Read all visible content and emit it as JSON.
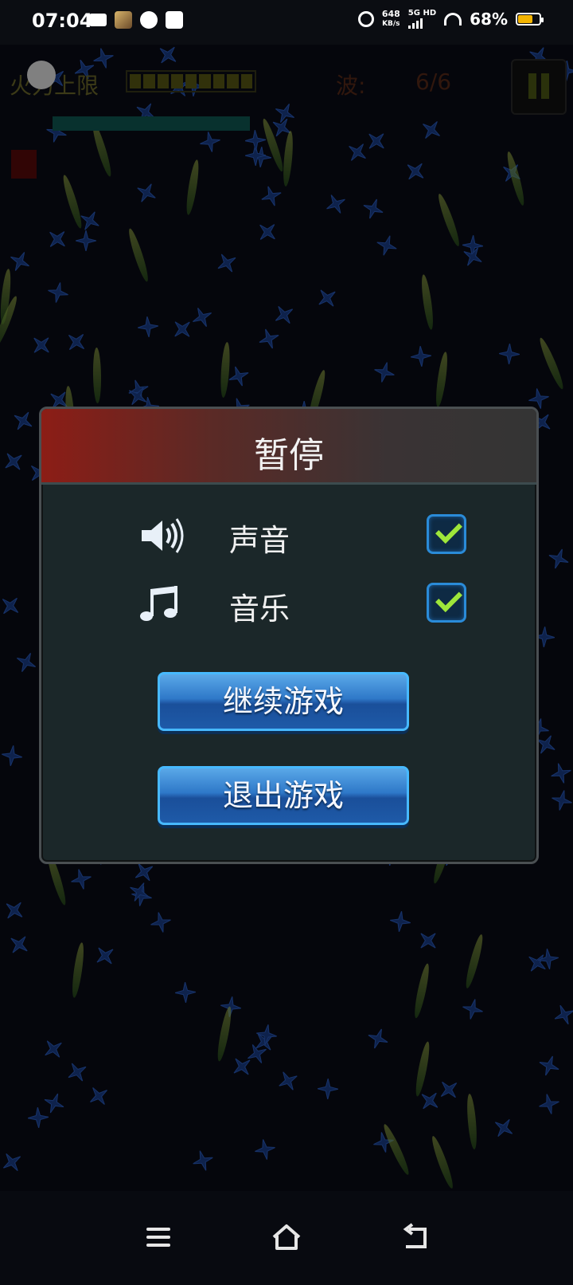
{
  "status_bar": {
    "time": "07:04",
    "speed_value": "648",
    "speed_unit": "KB/s",
    "network": "5G HD",
    "battery": "68%",
    "battery_level": 0.68,
    "battery_color": "#f4b400",
    "icons": [
      "video-icon",
      "app-avatar-icon",
      "chat-icon",
      "mail-icon",
      "alarm-icon",
      "signal-icon",
      "wifi-icon",
      "battery-icon"
    ]
  },
  "hud": {
    "firepower_label": "火力上限",
    "wave_label": "波:",
    "wave_value": "6/6"
  },
  "dialog": {
    "title": "暂停",
    "options": [
      {
        "label": "声音",
        "icon": "speaker-icon",
        "checked": true
      },
      {
        "label": "音乐",
        "icon": "music-note-icon",
        "checked": true
      }
    ],
    "continue_label": "继续游戏",
    "exit_label": "退出游戏"
  },
  "nav_bar": {
    "icons": [
      "menu-icon",
      "home-icon",
      "back-icon"
    ]
  }
}
